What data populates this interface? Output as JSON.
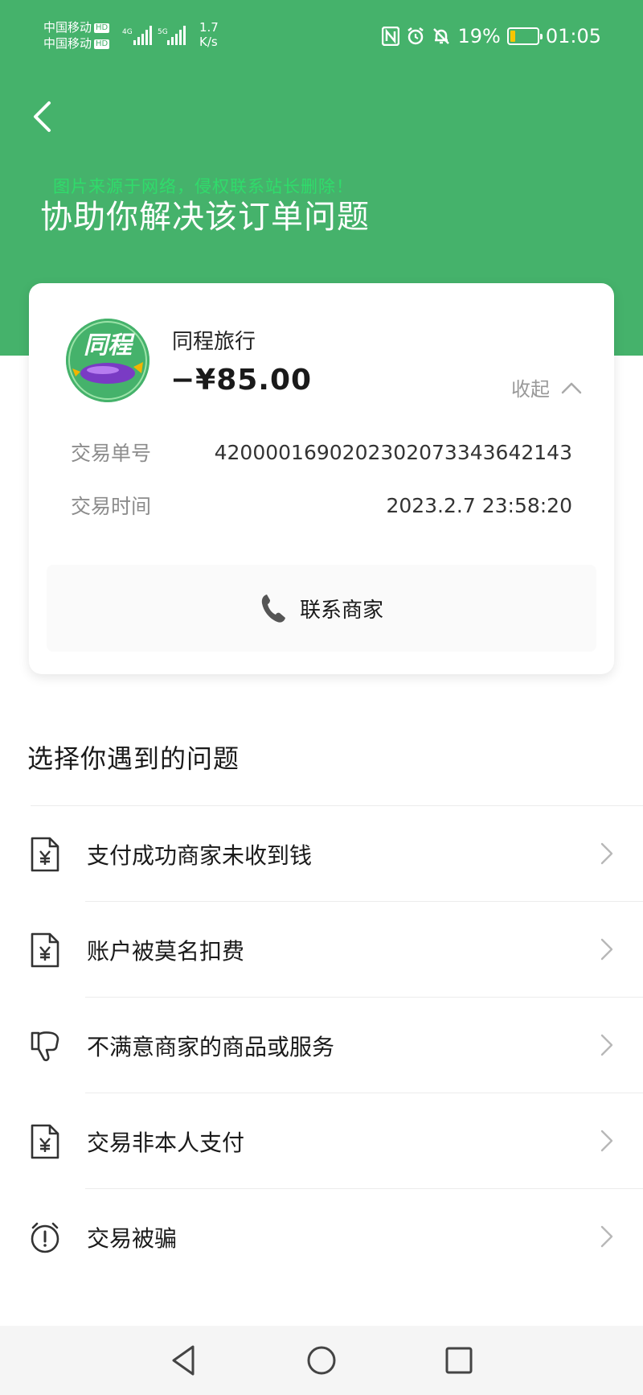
{
  "status_bar": {
    "carrier_1": "中国移动",
    "carrier_2": "中国移动",
    "hd_badge": "HD",
    "net_1": "4G",
    "net_2": "5G",
    "speed_value": "1.7",
    "speed_unit": "K/s",
    "battery": "19%",
    "battery_level": 0.19,
    "time": "01:05"
  },
  "watermark": "图片来源于网络，侵权联系站长删除！",
  "header": {
    "title": "协助你解决该订单问题"
  },
  "order_card": {
    "logo_text": "同程",
    "merchant_name": "同程旅行",
    "amount": "−¥85.00",
    "collapse_label": "收起",
    "rows": [
      {
        "label": "交易单号",
        "value": "4200001690202302073343642143"
      },
      {
        "label": "交易时间",
        "value": "2023.2.7 23:58:20"
      }
    ],
    "contact_label": "联系商家"
  },
  "issues": {
    "title": "选择你遇到的问题",
    "items": [
      {
        "label": "支付成功商家未收到钱",
        "icon": "receipt-yuan-icon"
      },
      {
        "label": "账户被莫名扣费",
        "icon": "receipt-yuan-icon"
      },
      {
        "label": "不满意商家的商品或服务",
        "icon": "thumbs-down-icon"
      },
      {
        "label": "交易非本人支付",
        "icon": "receipt-yuan-icon"
      },
      {
        "label": "交易被骗",
        "icon": "alert-clock-icon"
      }
    ]
  },
  "colors": {
    "brand_green": "#45b26b",
    "watermark_green": "#2ee06b",
    "battery_yellow": "#f7c600"
  }
}
